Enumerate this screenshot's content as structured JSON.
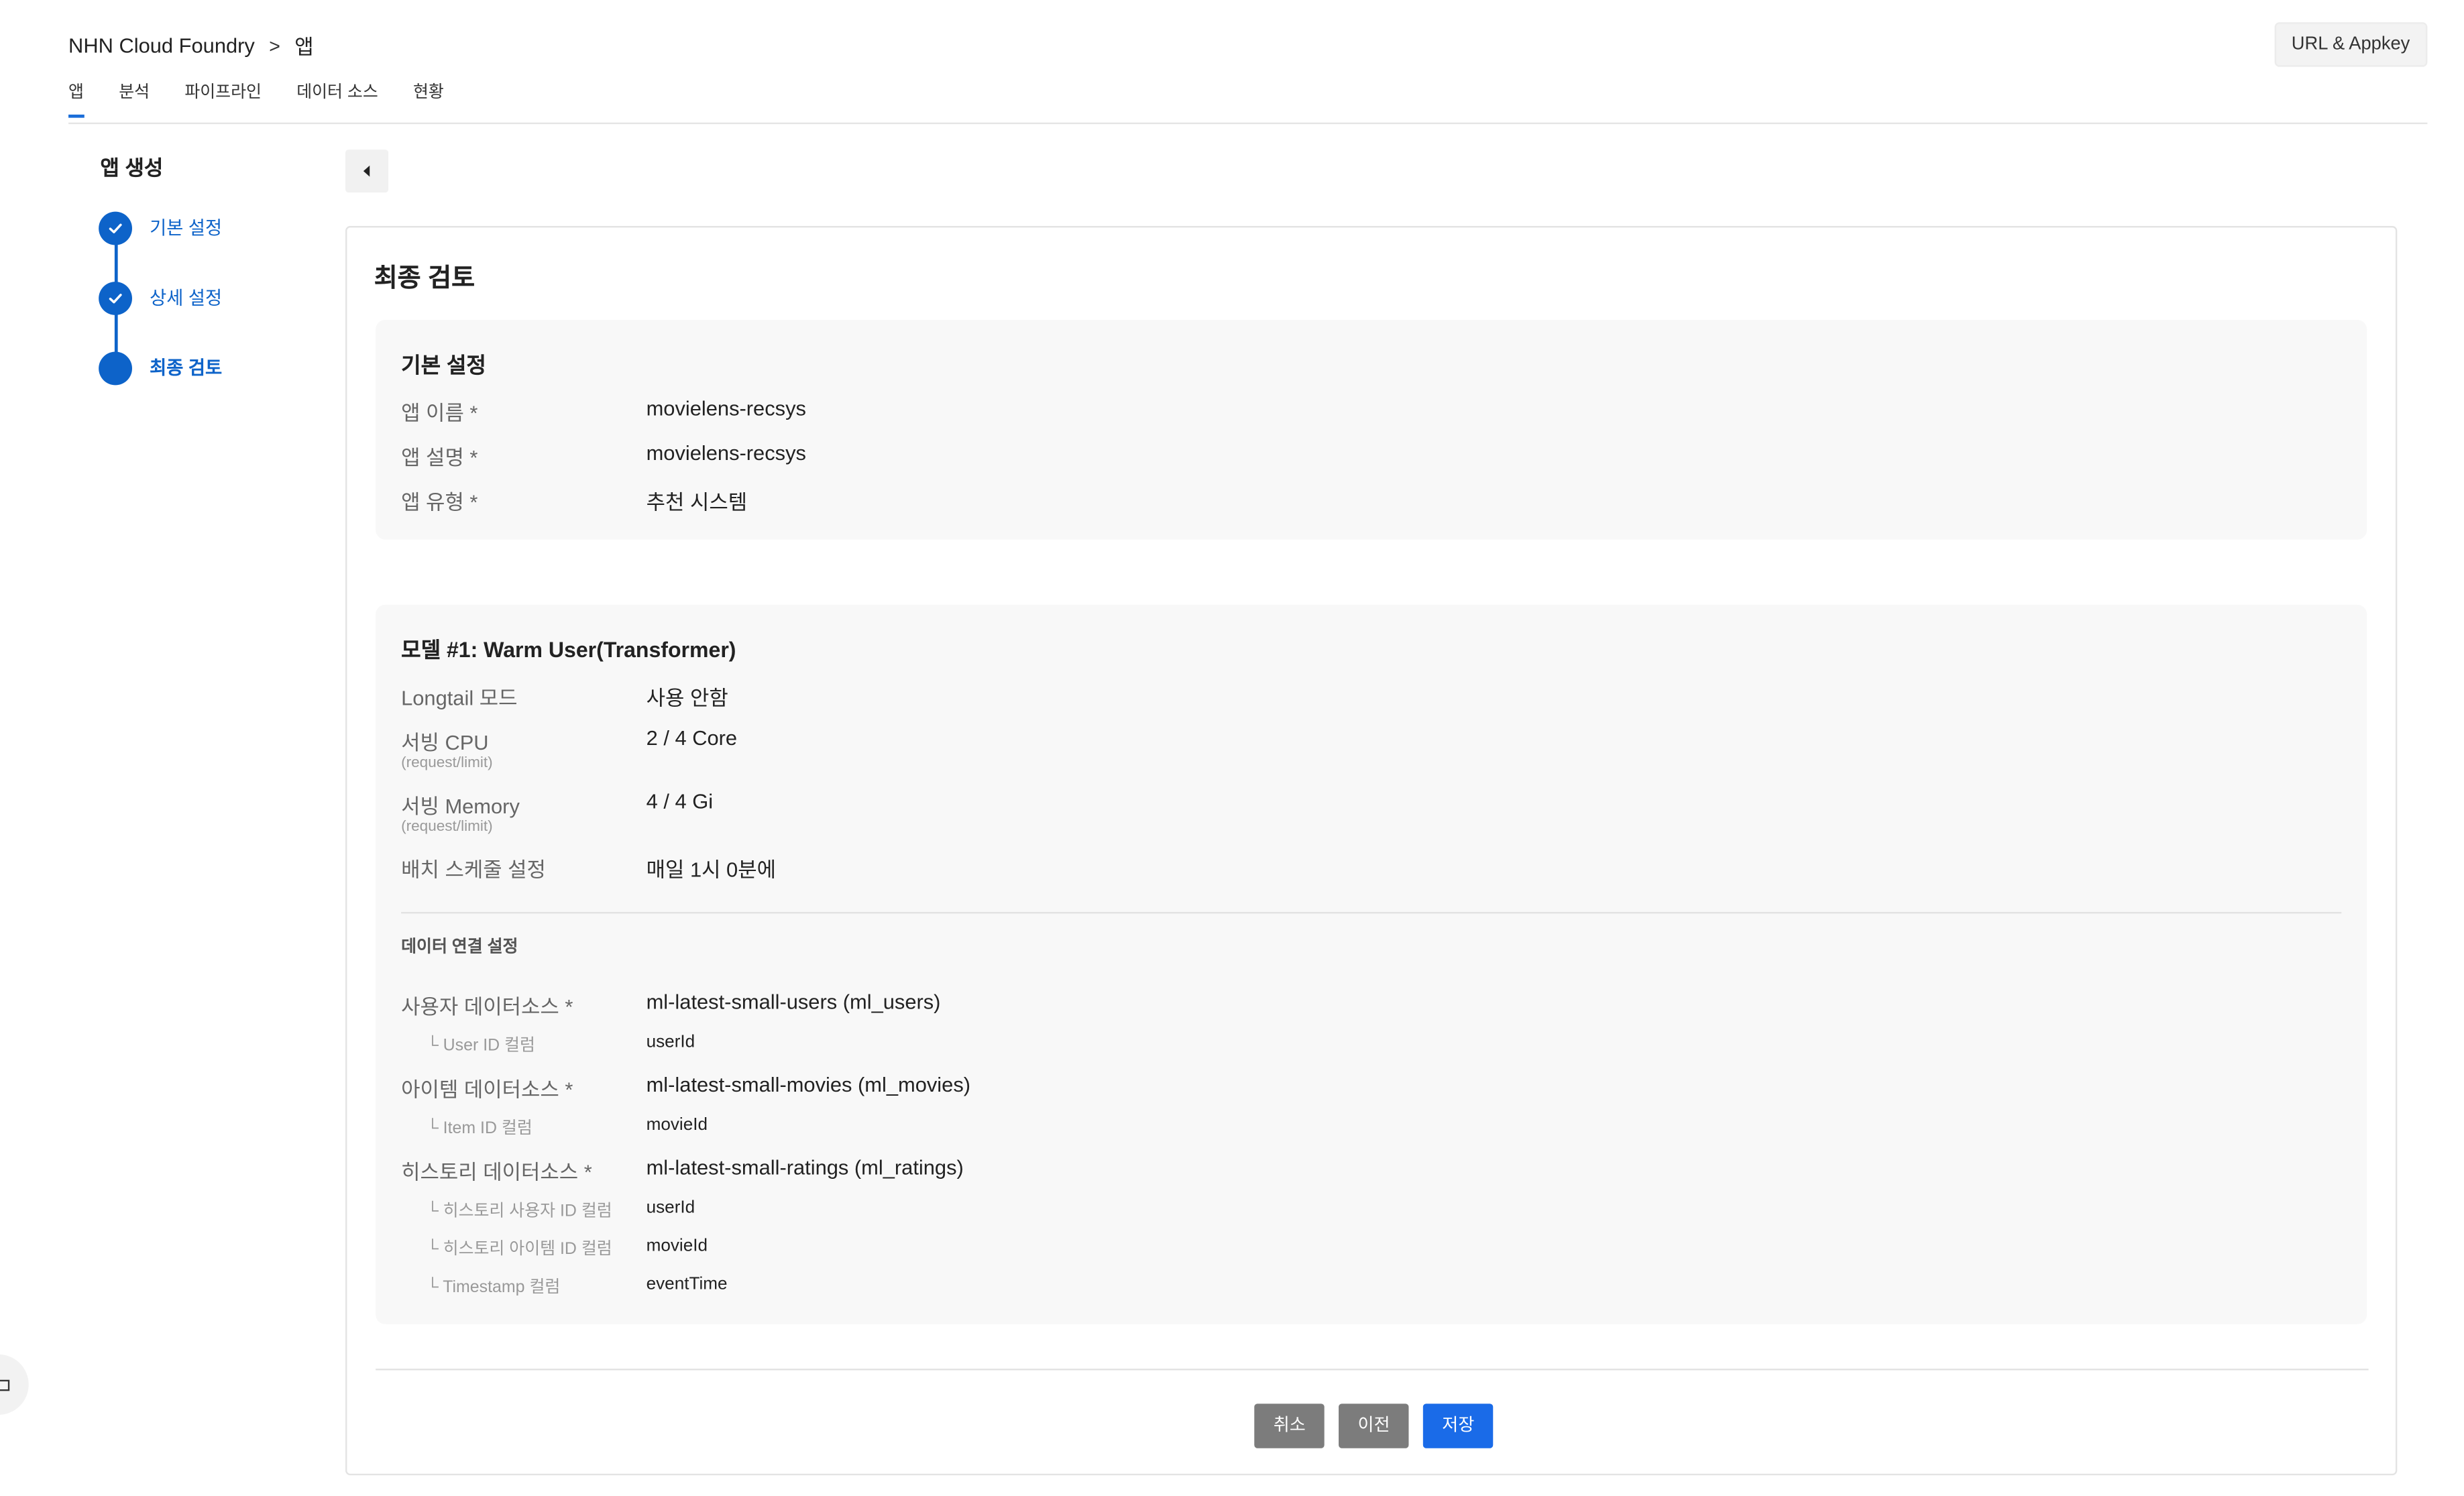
{
  "header": {
    "breadcrumb": [
      "NHN Cloud Foundry",
      "앱"
    ],
    "url_button": "URL & Appkey",
    "tabs": [
      "앱",
      "분석",
      "파이프라인",
      "데이터 소스",
      "현황"
    ]
  },
  "sidebar": {
    "title": "앱 생성",
    "steps": [
      {
        "label": "기본 설정",
        "state": "done"
      },
      {
        "label": "상세 설정",
        "state": "done"
      },
      {
        "label": "최종 검토",
        "state": "current"
      }
    ]
  },
  "card": {
    "title": "최종 검토",
    "basic": {
      "title": "기본 설정",
      "rows": [
        {
          "label": "앱 이름 *",
          "value": "movielens-recsys"
        },
        {
          "label": "앱 설명 *",
          "value": "movielens-recsys"
        },
        {
          "label": "앱 유형 *",
          "value": "추천 시스템"
        }
      ]
    },
    "model": {
      "title": "모델 #1: Warm User(Transformer)",
      "rows": [
        {
          "label": "Longtail 모드",
          "sub": "",
          "value": "사용 안함"
        },
        {
          "label": "서빙 CPU",
          "sub": "(request/limit)",
          "value": "2 / 4 Core"
        },
        {
          "label": "서빙 Memory",
          "sub": "(request/limit)",
          "value": "4 / 4 Gi"
        },
        {
          "label": "배치 스케줄 설정",
          "sub": "",
          "value": "매일 1시 0분에"
        }
      ],
      "data_title": "데이터 연결 설정",
      "data_rows": [
        {
          "label": "사용자 데이터소스 *",
          "value": "ml-latest-small-users (ml_users)"
        },
        {
          "label": "└ User ID 컬럼",
          "value": "userId"
        },
        {
          "label": "아이템 데이터소스 *",
          "value": "ml-latest-small-movies (ml_movies)"
        },
        {
          "label": "└ Item ID 컬럼",
          "value": "movieId"
        },
        {
          "label": "히스토리 데이터소스 *",
          "value": "ml-latest-small-ratings (ml_ratings)"
        },
        {
          "label": "└ 히스토리 사용자 ID 컬럼",
          "value": "userId"
        },
        {
          "label": "└ 히스토리 아이템 ID 컬럼",
          "value": "movieId"
        },
        {
          "label": "└ Timestamp 컬럼",
          "value": "eventTime"
        }
      ]
    },
    "buttons": {
      "cancel": "취소",
      "prev": "이전",
      "save": "저장"
    }
  },
  "colors": {
    "accent": "#0d63c9",
    "save_button": "#1a6be8",
    "gray_button": "#7c7c7c"
  }
}
